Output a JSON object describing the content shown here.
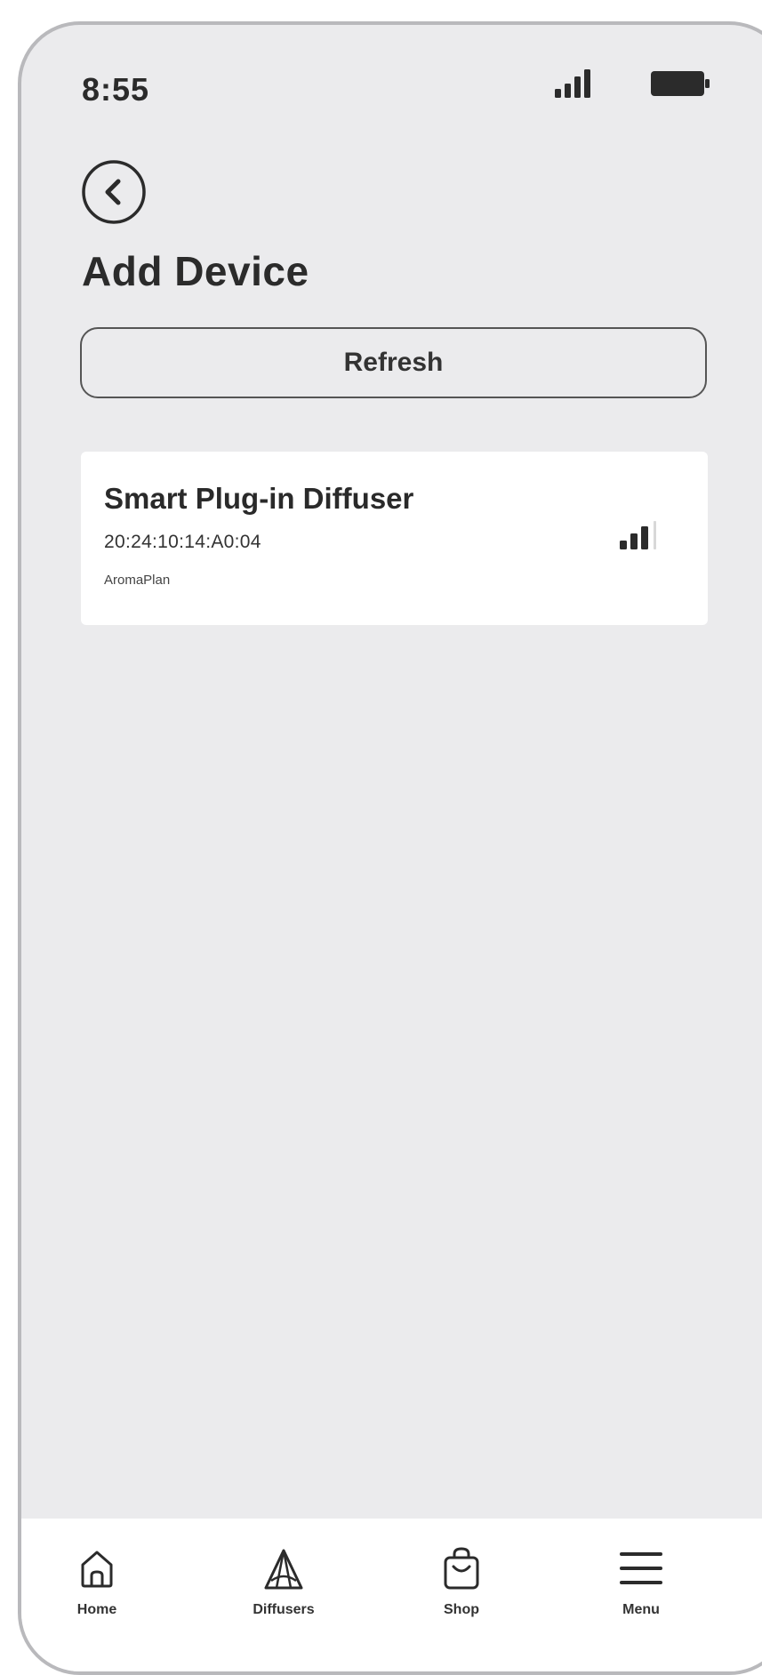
{
  "status_bar": {
    "time": "8:55"
  },
  "header": {
    "title": "Add Device"
  },
  "actions": {
    "refresh_label": "Refresh"
  },
  "devices": [
    {
      "name": "Smart Plug-in Diffuser",
      "mac": "20:24:10:14:A0:04",
      "brand": "AromaPlan",
      "signal_icon": "signal-strength-icon"
    }
  ],
  "tab_bar": {
    "tabs": [
      {
        "label": "Home",
        "icon": "home-icon"
      },
      {
        "label": "Diffusers",
        "icon": "diffuser-icon"
      },
      {
        "label": "Shop",
        "icon": "shopping-bag-icon"
      },
      {
        "label": "Menu",
        "icon": "menu-icon"
      }
    ]
  },
  "colors": {
    "background": "#ebebed",
    "card": "#ffffff",
    "text": "#2b2b2b",
    "frame": "#b9b9bc"
  }
}
